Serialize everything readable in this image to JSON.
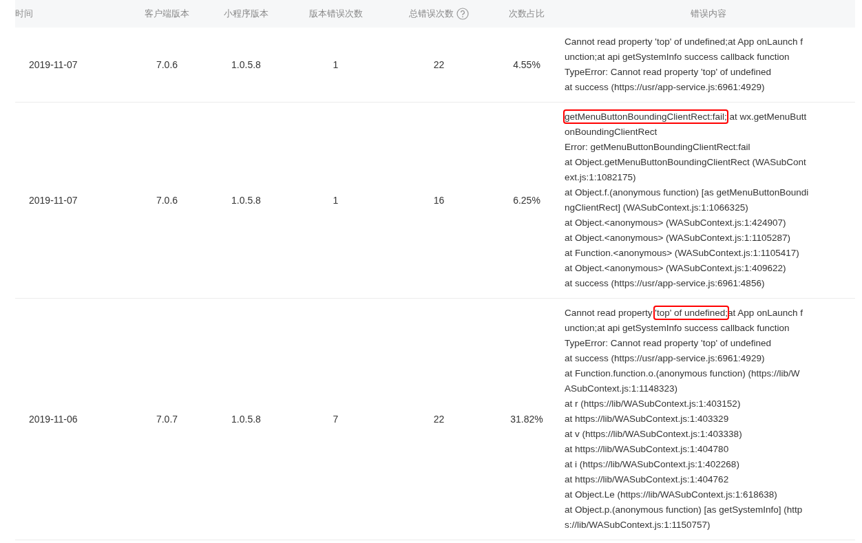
{
  "table": {
    "columns": [
      {
        "label": "时间",
        "help": false
      },
      {
        "label": "客户端版本",
        "help": false
      },
      {
        "label": "小程序版本",
        "help": false
      },
      {
        "label": "版本错误次数",
        "help": false
      },
      {
        "label": "总错误次数",
        "help": true
      },
      {
        "label": "次数占比",
        "help": false
      },
      {
        "label": "错误内容",
        "help": false
      }
    ],
    "rows": [
      {
        "date": "2019-11-07",
        "client_version": "7.0.6",
        "app_version": "1.0.5.8",
        "version_errors": "1",
        "total_errors": "22",
        "share": "4.55%",
        "error_lines": [
          [
            {
              "text": "Cannot read property 'top' of undefined;at App onLaunch f",
              "highlighted": false
            }
          ],
          [
            {
              "text": "unction;at api getSystemInfo success callback function",
              "highlighted": false
            }
          ],
          [
            {
              "text": "TypeError: Cannot read property 'top' of undefined",
              "highlighted": false
            }
          ],
          [
            {
              "text": "at success (https://usr/app-service.js:6961:4929)",
              "highlighted": false
            }
          ]
        ]
      },
      {
        "date": "2019-11-07",
        "client_version": "7.0.6",
        "app_version": "1.0.5.8",
        "version_errors": "1",
        "total_errors": "16",
        "share": "6.25%",
        "error_lines": [
          [
            {
              "text": "getMenuButtonBoundingClientRect:fail;",
              "highlighted": true
            },
            {
              "text": " at wx.getMenuButt",
              "highlighted": false
            }
          ],
          [
            {
              "text": "onBoundingClientRect",
              "highlighted": false
            }
          ],
          [
            {
              "text": "Error: getMenuButtonBoundingClientRect:fail",
              "highlighted": false
            }
          ],
          [
            {
              "text": "at Object.getMenuButtonBoundingClientRect (WASubCont",
              "highlighted": false
            }
          ],
          [
            {
              "text": "ext.js:1:1082175)",
              "highlighted": false
            }
          ],
          [
            {
              "text": "at Object.f.(anonymous function) [as getMenuButtonBoundi",
              "highlighted": false
            }
          ],
          [
            {
              "text": "ngClientRect] (WASubContext.js:1:1066325)",
              "highlighted": false
            }
          ],
          [
            {
              "text": "at Object.<anonymous> (WASubContext.js:1:424907)",
              "highlighted": false
            }
          ],
          [
            {
              "text": "at Object.<anonymous> (WASubContext.js:1:1105287)",
              "highlighted": false
            }
          ],
          [
            {
              "text": "at Function.<anonymous> (WASubContext.js:1:1105417)",
              "highlighted": false
            }
          ],
          [
            {
              "text": "at Object.<anonymous> (WASubContext.js:1:409622)",
              "highlighted": false
            }
          ],
          [
            {
              "text": "at success (https://usr/app-service.js:6961:4856)",
              "highlighted": false
            }
          ]
        ]
      },
      {
        "date": "2019-11-06",
        "client_version": "7.0.7",
        "app_version": "1.0.5.8",
        "version_errors": "7",
        "total_errors": "22",
        "share": "31.82%",
        "error_lines": [
          [
            {
              "text": "Cannot read property ",
              "highlighted": false
            },
            {
              "text": "'top' of undefined;",
              "highlighted": true
            },
            {
              "text": "at App onLaunch f",
              "highlighted": false
            }
          ],
          [
            {
              "text": "unction;at api getSystemInfo success callback function",
              "highlighted": false
            }
          ],
          [
            {
              "text": "TypeError: Cannot read property 'top' of undefined",
              "highlighted": false
            }
          ],
          [
            {
              "text": "at success (https://usr/app-service.js:6961:4929)",
              "highlighted": false
            }
          ],
          [
            {
              "text": "at Function.function.o.(anonymous function) (https://lib/W",
              "highlighted": false
            }
          ],
          [
            {
              "text": "ASubContext.js:1:1148323)",
              "highlighted": false
            }
          ],
          [
            {
              "text": "at r (https://lib/WASubContext.js:1:403152)",
              "highlighted": false
            }
          ],
          [
            {
              "text": "at https://lib/WASubContext.js:1:403329",
              "highlighted": false
            }
          ],
          [
            {
              "text": "at v (https://lib/WASubContext.js:1:403338)",
              "highlighted": false
            }
          ],
          [
            {
              "text": "at https://lib/WASubContext.js:1:404780",
              "highlighted": false
            }
          ],
          [
            {
              "text": "at i (https://lib/WASubContext.js:1:402268)",
              "highlighted": false
            }
          ],
          [
            {
              "text": "at https://lib/WASubContext.js:1:404762",
              "highlighted": false
            }
          ],
          [
            {
              "text": "at Object.Le (https://lib/WASubContext.js:1:618638)",
              "highlighted": false
            }
          ],
          [
            {
              "text": "at Object.p.(anonymous function) [as getSystemInfo] (http",
              "highlighted": false
            }
          ],
          [
            {
              "text": "s://lib/WASubContext.js:1:1150757)",
              "highlighted": false
            }
          ]
        ]
      }
    ]
  }
}
